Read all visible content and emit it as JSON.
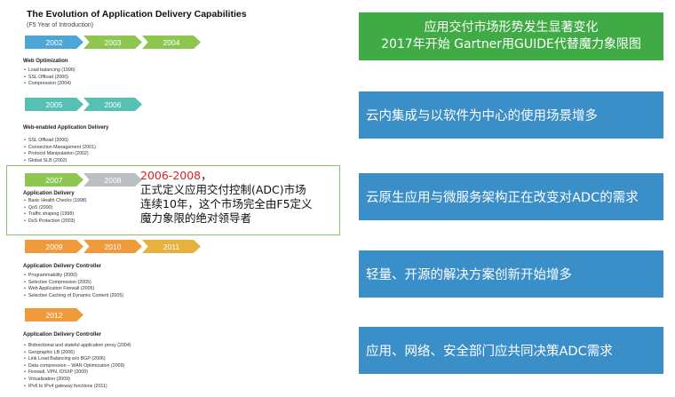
{
  "left": {
    "title": "The Evolution of Application Delivery Capabilities",
    "subtitle": "(F5 Year of Introduction)",
    "rows": [
      [
        "2002",
        "2003",
        "2004"
      ],
      [
        "2005",
        "2006"
      ],
      [
        "2007",
        "2008"
      ],
      [
        "2009",
        "2010",
        "2011"
      ],
      [
        "2012"
      ]
    ],
    "sections": [
      {
        "heading": "Web Optimization",
        "items": [
          "Load balancing (1996)",
          "SSL Offload (2000)",
          "Compression (2004)"
        ]
      },
      {
        "heading": "Web-enabled Application Delivery",
        "items": [
          "SSL Offload (2000)",
          "Connection Management (2001)",
          "Protocol Manipulation (2002)",
          "Global SLB (2002)"
        ]
      },
      {
        "heading": "Application Delivery",
        "items": [
          "Basic Health Checks (1998)",
          "QoS (2000)",
          "Traffic shaping (1998)",
          "DoS Protection (2003)"
        ]
      },
      {
        "heading": "Application Delivery Controller",
        "items": [
          "Programmability (2000)",
          "Selective Compression (2005)",
          "Web Application Firewall (2005)",
          "Selective Caching of Dynamic Content (2005)"
        ]
      },
      {
        "heading": "Application Delivery Controller",
        "items": [
          "Bidirectional and stateful application proxy (2004)",
          "Geographic LB (2006)",
          "Link Load Balancing w/o BGP (2006)",
          "Data compression – WAN Optimization (2009)",
          "Firewall, VPN, IDS/IP (2009)",
          "Virtualization (2009)",
          "IPv6 to IPv4 gateway functions (2011)"
        ]
      }
    ]
  },
  "overlay": {
    "years": "2006-2008",
    "lines": [
      "正式定义应用交付控制(ADC)市场",
      "连续10年，这个市场完全由F5定义",
      "魔力象限的绝对领导者"
    ]
  },
  "right": {
    "headline": [
      "应用交付市场形势发生显著变化",
      "2017年开始 Gartner用GUIDE代替魔力象限图"
    ],
    "points": [
      "云内集成与以软件为中心的使用场景增多",
      "云原生应用与微服务架构正在改变对ADC的需求",
      "轻量、开源的解决方案创新开始增多",
      "应用、网络、安全部门应共同决策ADC需求"
    ]
  },
  "colors": {
    "headline_bg": "#40ab44",
    "point_bg": "#3b8fc8",
    "highlight_border": "#8cc26b",
    "overlay_year": "#e02020"
  }
}
